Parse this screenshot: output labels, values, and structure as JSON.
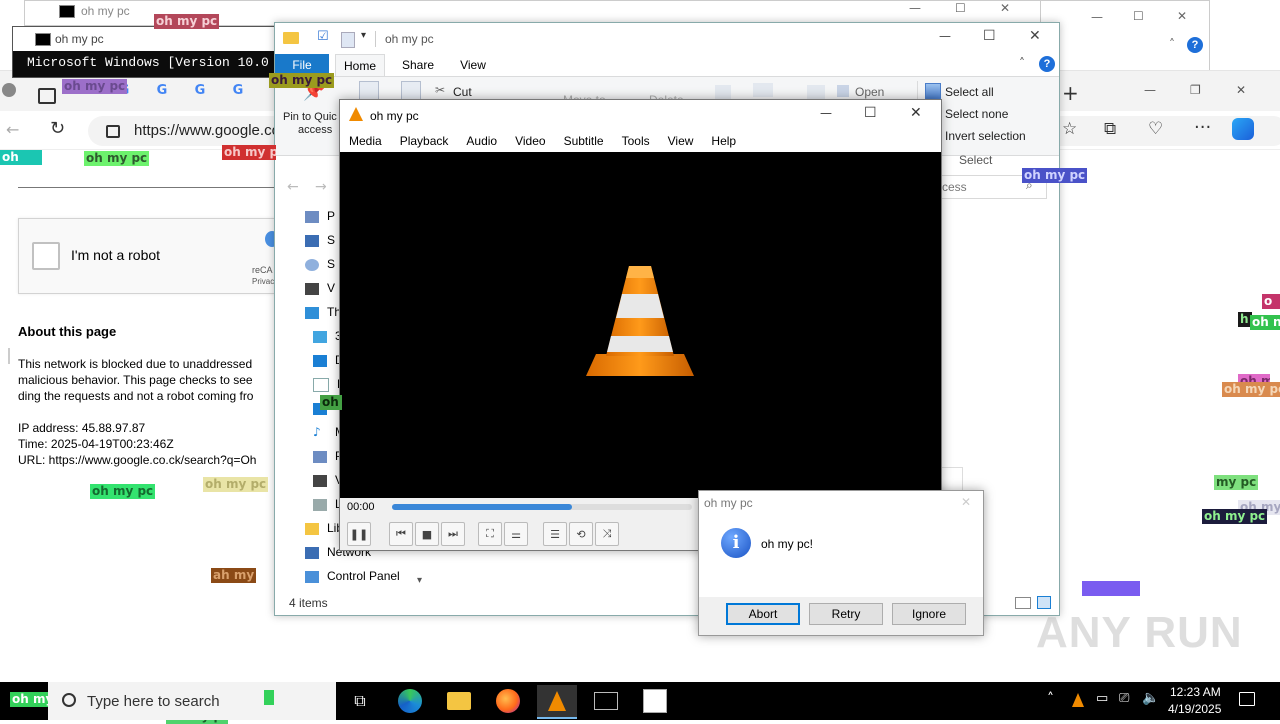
{
  "spam_labels": {
    "text": "oh my pc",
    "text_short": "oh my",
    "text_partial": "ah my",
    "text_tail": "my pc",
    "text_cut": "oh n",
    "text_h": "h",
    "text_oh": "oh",
    "text_o": "o"
  },
  "top_window": {
    "title": "oh my pc"
  },
  "cmd": {
    "title": "oh my pc",
    "line": "Microsoft Windows [Version 10.0"
  },
  "browser": {
    "url": "https://www.google.co",
    "about_heading": "About this page",
    "about_text_1": "This network is blocked due to unaddressed",
    "about_text_2": "malicious behavior. This page checks to see",
    "about_text_3": "ding the requests and not a robot coming fro",
    "ip": "IP address: 45.88.97.87",
    "time": "Time: 2025-04-19T00:23:46Z",
    "url_line": "URL: https://www.google.co.ck/search?q=Oh",
    "captcha_label": "I'm not a robot",
    "recaptcha_1": "reCA",
    "recaptcha_2": "Privac"
  },
  "explorer": {
    "title": "oh my pc",
    "tabs": [
      "File",
      "Home",
      "Share",
      "View"
    ],
    "pin_label_1": "Pin to Quic",
    "pin_label_2": "access",
    "cut": "Cut",
    "move_to": "Move to",
    "delete": "Delete",
    "open": "Open",
    "select_all": "Select all",
    "select_none": "Select none",
    "invert_selection": "Invert selection",
    "select_group": "Select",
    "search_partial": "ccess",
    "tree": [
      "P",
      "S",
      "S",
      "V",
      "Th",
      "3",
      "D",
      "D",
      "",
      "M",
      "P",
      "V",
      "L",
      "Lib",
      "Network",
      "Control Panel"
    ],
    "status": "4 items"
  },
  "vlc": {
    "title": "oh my pc",
    "menu": [
      "Media",
      "Playback",
      "Audio",
      "Video",
      "Subtitle",
      "Tools",
      "View",
      "Help"
    ],
    "time": "00:00",
    "progress_fraction": 0.6
  },
  "msgbox": {
    "title": "oh my pc",
    "message": "oh my pc!",
    "buttons": [
      "Abort",
      "Retry",
      "Ignore"
    ]
  },
  "taskbar": {
    "search_placeholder": "Type here to search",
    "time": "12:23 AM",
    "date": "4/19/2025"
  },
  "watermark": "ANY RUN",
  "colors": {
    "accent": "#0078d7",
    "vlc_orange": "#f08a00",
    "file_tab": "#1979ca"
  }
}
